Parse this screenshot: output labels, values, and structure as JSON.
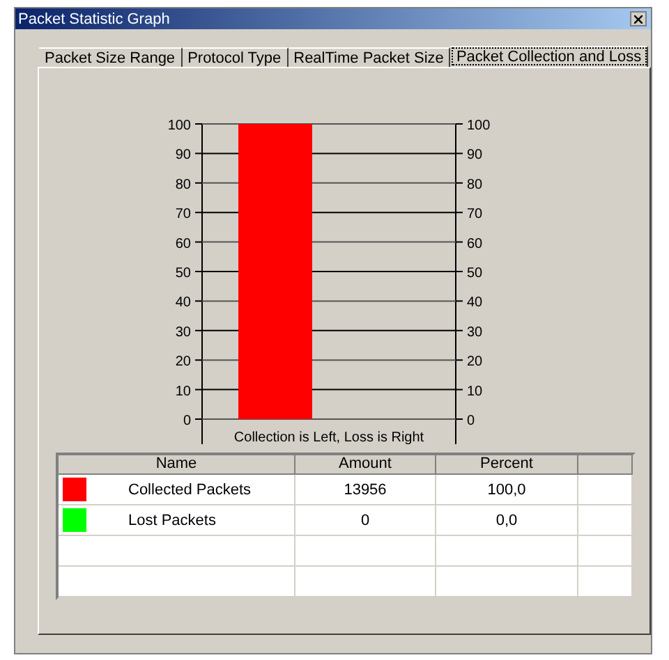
{
  "window": {
    "title": "Packet Statistic Graph"
  },
  "tabs": [
    {
      "label": "Packet Size Range",
      "selected": false
    },
    {
      "label": "Protocol Type",
      "selected": false
    },
    {
      "label": "RealTime Packet Size",
      "selected": false
    },
    {
      "label": "Packet Collection and Loss",
      "selected": true
    }
  ],
  "chart_data": {
    "type": "bar",
    "xlabel": "Collection is Left, Loss is Right",
    "ylim": [
      0,
      100
    ],
    "grid": true,
    "yticks": [
      0,
      10,
      20,
      30,
      40,
      50,
      60,
      70,
      80,
      90,
      100
    ],
    "y2lim": [
      0,
      100
    ],
    "y2ticks": [
      0,
      10,
      20,
      30,
      40,
      50,
      60,
      70,
      80,
      90,
      100
    ],
    "series": [
      {
        "color": "#ff0000",
        "values": [
          100,
          null
        ]
      },
      {
        "color": "#00ff00",
        "values": [
          null,
          0
        ]
      }
    ]
  },
  "table": {
    "columns": [
      "Name",
      "Amount",
      "Percent"
    ],
    "rows": [
      {
        "color": "#ff0000",
        "name": "Collected Packets",
        "amount": "13956",
        "percent": "100,0"
      },
      {
        "color": "#00ff00",
        "name": "Lost Packets",
        "amount": "0",
        "percent": "0,0"
      }
    ]
  }
}
